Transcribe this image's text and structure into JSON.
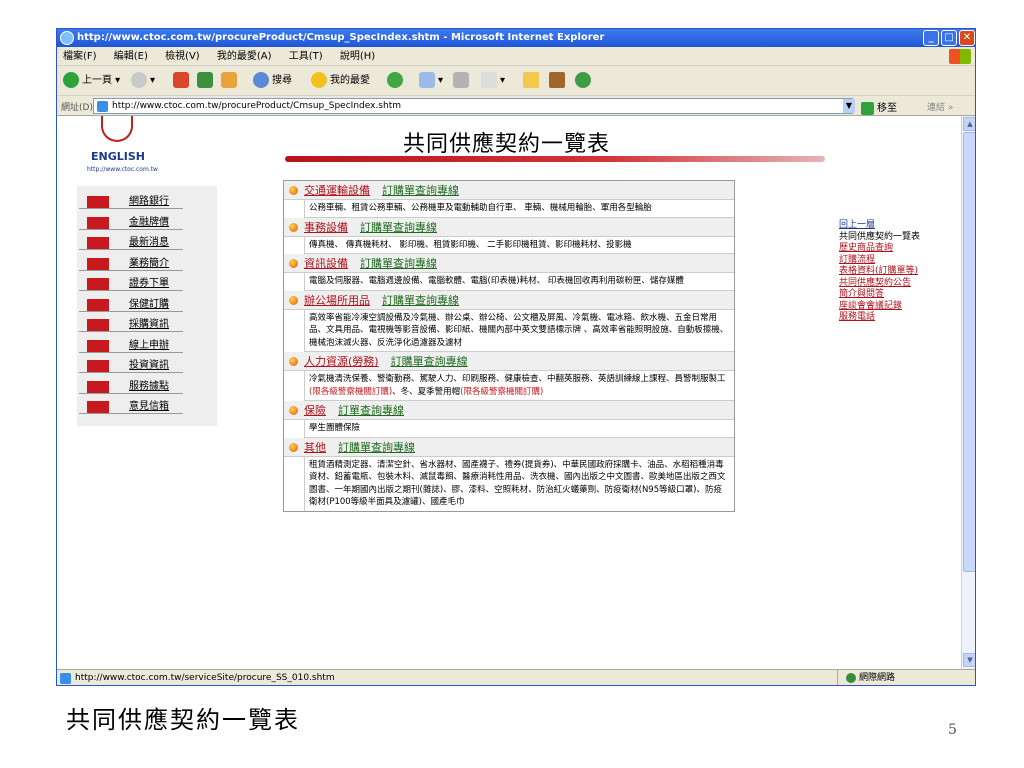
{
  "window": {
    "title": "http://www.ctoc.com.tw/procureProduct/Cmsup_SpecIndex.shtm - Microsoft Internet Explorer",
    "min": "_",
    "max": "□",
    "close": "✕"
  },
  "menu": [
    "檔案(F)",
    "編輯(E)",
    "檢視(V)",
    "我的最愛(A)",
    "工具(T)",
    "說明(H)"
  ],
  "toolbar": {
    "back": "上一頁",
    "search": "搜尋",
    "favorites": "我的最愛"
  },
  "address": {
    "label": "網址(D)",
    "url": "http://www.ctoc.com.tw/procureProduct/Cmsup_SpecIndex.shtm",
    "go": "移至",
    "links": "連結 »"
  },
  "logo": {
    "text": "ENGLISH",
    "url": "http://www.ctoc.com.tw"
  },
  "nav": [
    "網路銀行",
    "金融牌價",
    "最新消息",
    "業務簡介",
    "證券下單",
    "保健訂購",
    "採購資訊",
    "線上申辦",
    "投資資訊",
    "服務據點",
    "意見信箱"
  ],
  "heading": "共同供應契約一覽表",
  "categories": [
    {
      "title": "交通運輸設備",
      "sub": "訂購單查詢專線",
      "body": "公務車輛、租賃公務車輛、公務機車及電動輔助自行車、 車輛、機械用輪胎、軍用各型輪胎"
    },
    {
      "title": "事務設備",
      "sub": "訂購單查詢專線",
      "body": "傳真機、 傳真機耗材、 影印機、租賃影印機、 二手影印機租賃、影印機耗材、投影機"
    },
    {
      "title": "資訊設備",
      "sub": "訂購單查詢專線",
      "body": "電腦及伺服器、電腦週邊設備、電腦軟體、電腦(印表機)耗材、 印表機回收再利用碳粉匣、儲存媒體"
    },
    {
      "title": "辦公場所用品",
      "sub": "訂購單查詢專線",
      "body": "高效率省能冷凍空調設備及冷氣機、辦公桌、辦公椅、公文櫃及屏風、冷氣機、電冰箱、飲水機、五金日常用品、文具用品、電視機等影音設備、影印紙、機關內部中英文雙語標示牌 、高效率省能照明設施、自動板擦機、機械泡沫滅火器、反洗淨化過濾器及濾材"
    },
    {
      "title": "人力資源(勞務)",
      "sub": "訂購單查詢專線",
      "body": "冷氣機清洗保養、警衛勤務、駕駛人力、印刷服務、健康檢查、中翻英服務、英語訓練線上課程、員警制服製工",
      "red1": "(限各級警察機關訂購)",
      "body2": "、冬、夏季警用帽",
      "red2": "(限各級警察機關訂購)"
    },
    {
      "title": "保險",
      "sub": "訂單查詢專線",
      "body": "學生團體保險"
    },
    {
      "title": "其他",
      "sub": "訂購單查詢專線",
      "body": "租賃酒精測定器、清潔空針、省水器材、國產襪子、禮券(提貨券)、中華民國政府採購卡、油品、水稻稻種消毒資材、鉛蓄電瓶、包裝木料、滅鼠毒餌、醫療消耗性用品、洗衣機、國內出版之中文圖書、歐美地區出版之西文圖書、一年期國內出版之期刊(雜誌)、膠、漆料、空照耗材、防治紅火蟻藥劑、防疫衛材(N95等級口罩)、防疫衛材(P100等級半面具及濾罐)、國產毛巾"
    }
  ],
  "rightlinks": [
    "回上一層",
    "共同供應契約一覽表",
    "歷史商品查詢",
    "訂購流程",
    "表格資料(訂購單等)",
    "共同供應契約公告",
    "簡介與問答",
    "座談會會議記錄",
    "服務電話"
  ],
  "status": {
    "text": "http://www.ctoc.com.tw/serviceSite/procure_SS_010.shtm",
    "zone": "網際網路"
  },
  "slide": {
    "caption": "共同供應契約一覽表",
    "page": "5"
  }
}
